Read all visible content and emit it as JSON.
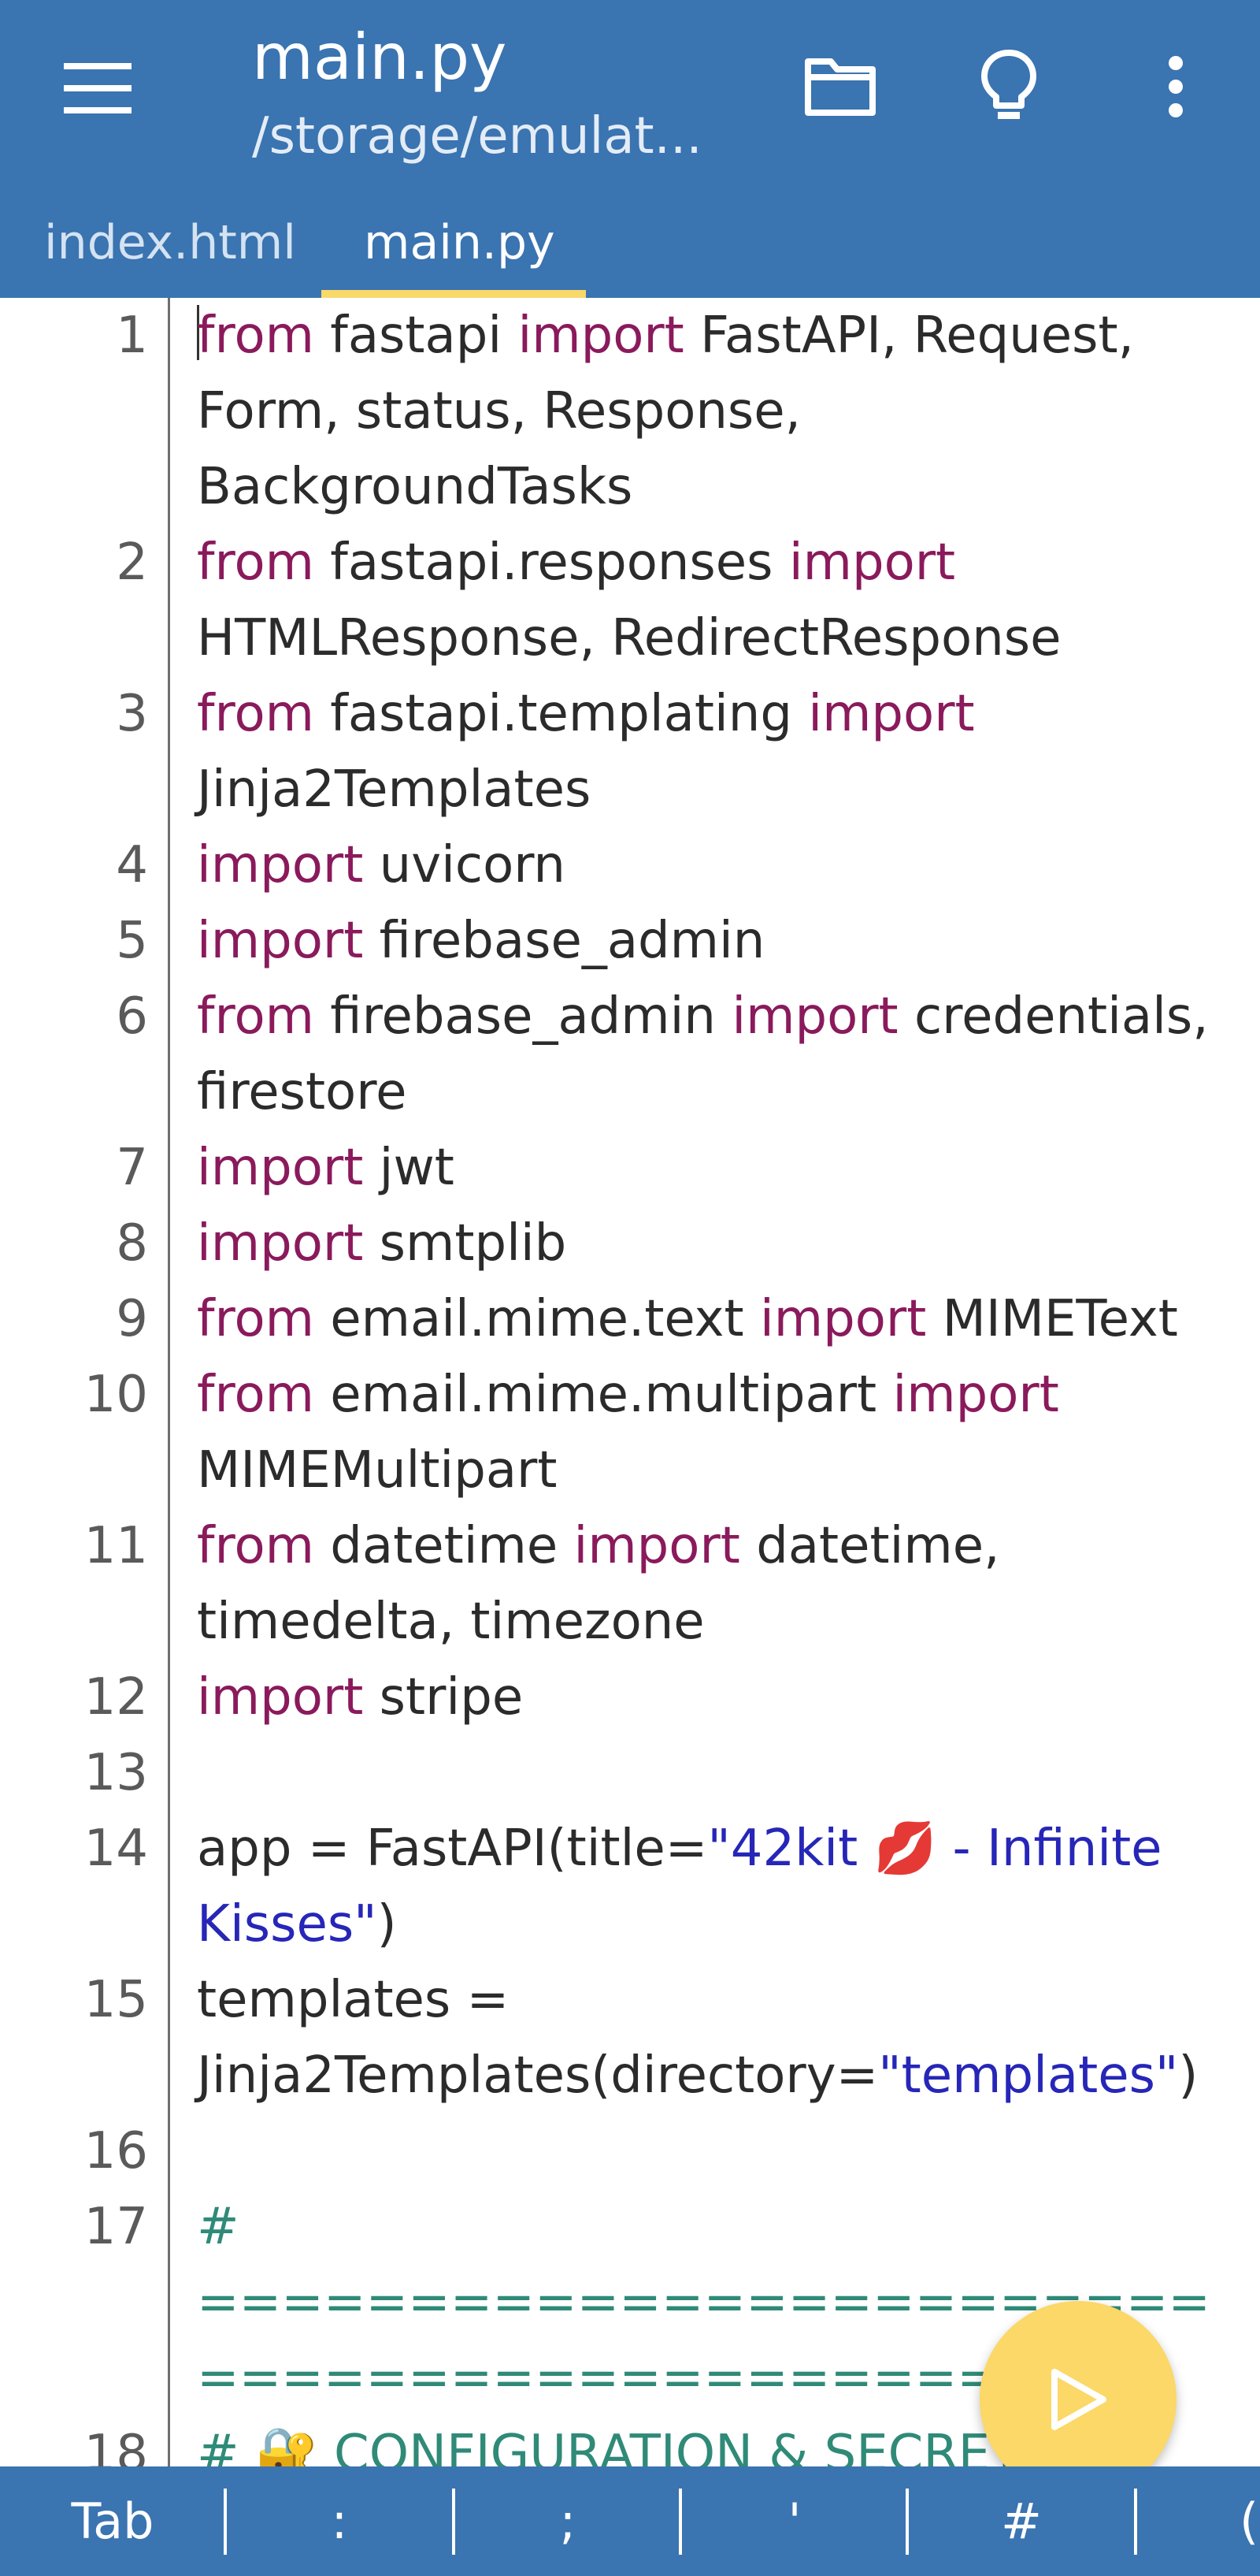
{
  "header": {
    "title": "main.py",
    "subtitle": "/storage/emulat...",
    "icons": [
      "menu-icon",
      "folder-icon",
      "lightbulb-icon",
      "more-vert-icon"
    ]
  },
  "tabs": [
    {
      "label": "index.html",
      "active": false
    },
    {
      "label": "main.py",
      "active": true
    }
  ],
  "editor": {
    "lines": [
      {
        "num": "1",
        "parts": [
          [
            "kw",
            "from"
          ],
          [
            "t",
            " fastapi "
          ],
          [
            "kw",
            "import"
          ],
          [
            "t",
            " FastAPI, Request, Form, status, Response, BackgroundTasks"
          ]
        ]
      },
      {
        "num": "2",
        "parts": [
          [
            "kw",
            "from"
          ],
          [
            "t",
            " fastapi.responses "
          ],
          [
            "kw",
            "import"
          ],
          [
            "t",
            " HTMLResponse, RedirectResponse"
          ]
        ]
      },
      {
        "num": "3",
        "parts": [
          [
            "kw",
            "from"
          ],
          [
            "t",
            " fastapi.templating "
          ],
          [
            "kw",
            "import"
          ],
          [
            "t",
            " Jinja2Templates"
          ]
        ]
      },
      {
        "num": "4",
        "parts": [
          [
            "kw",
            "import"
          ],
          [
            "t",
            " uvicorn"
          ]
        ]
      },
      {
        "num": "5",
        "parts": [
          [
            "kw",
            "import"
          ],
          [
            "t",
            " firebase_admin"
          ]
        ]
      },
      {
        "num": "6",
        "parts": [
          [
            "kw",
            "from"
          ],
          [
            "t",
            " firebase_admin "
          ],
          [
            "kw",
            "import"
          ],
          [
            "t",
            " credentials, firestore"
          ]
        ]
      },
      {
        "num": "7",
        "parts": [
          [
            "kw",
            "import"
          ],
          [
            "t",
            " jwt"
          ]
        ]
      },
      {
        "num": "8",
        "parts": [
          [
            "kw",
            "import"
          ],
          [
            "t",
            " smtplib"
          ]
        ]
      },
      {
        "num": "9",
        "parts": [
          [
            "kw",
            "from"
          ],
          [
            "t",
            " email.mime.text "
          ],
          [
            "kw",
            "import"
          ],
          [
            "t",
            " MIMEText"
          ]
        ]
      },
      {
        "num": "10",
        "parts": [
          [
            "kw",
            "from"
          ],
          [
            "t",
            " email.mime.multipart "
          ],
          [
            "kw",
            "import"
          ],
          [
            "t",
            " MIMEMultipart"
          ]
        ]
      },
      {
        "num": "11",
        "parts": [
          [
            "kw",
            "from"
          ],
          [
            "t",
            " datetime "
          ],
          [
            "kw",
            "import"
          ],
          [
            "t",
            " datetime, timedelta, timezone"
          ]
        ]
      },
      {
        "num": "12",
        "parts": [
          [
            "kw",
            "import"
          ],
          [
            "t",
            " stripe"
          ]
        ]
      },
      {
        "num": "13",
        "parts": []
      },
      {
        "num": "14",
        "parts": [
          [
            "t",
            "app = FastAPI(title="
          ],
          [
            "str",
            "\"42kit 💋 - Infinite Kisses\""
          ],
          [
            "t",
            ")"
          ]
        ]
      },
      {
        "num": "15",
        "parts": [
          [
            "t",
            "templates = Jinja2Templates(directory="
          ],
          [
            "str",
            "\"templates\""
          ],
          [
            "t",
            ")"
          ]
        ]
      },
      {
        "num": "16",
        "parts": []
      },
      {
        "num": "17",
        "parts": [
          [
            "cmt",
            "# ============================================="
          ]
        ]
      },
      {
        "num": "18",
        "parts": [
          [
            "cmt",
            "# 🔐 CONFIGURATION & SECRETS"
          ]
        ]
      }
    ]
  },
  "symbols": [
    "Tab",
    ":",
    ";",
    "'",
    "#",
    "("
  ],
  "colors": {
    "primary": "#3a74b1",
    "tab_indicator": "#f8d96a",
    "fab": "#fbd867",
    "keyword": "#8a1a5c",
    "string": "#2626b8",
    "comment": "#2f8a78"
  }
}
